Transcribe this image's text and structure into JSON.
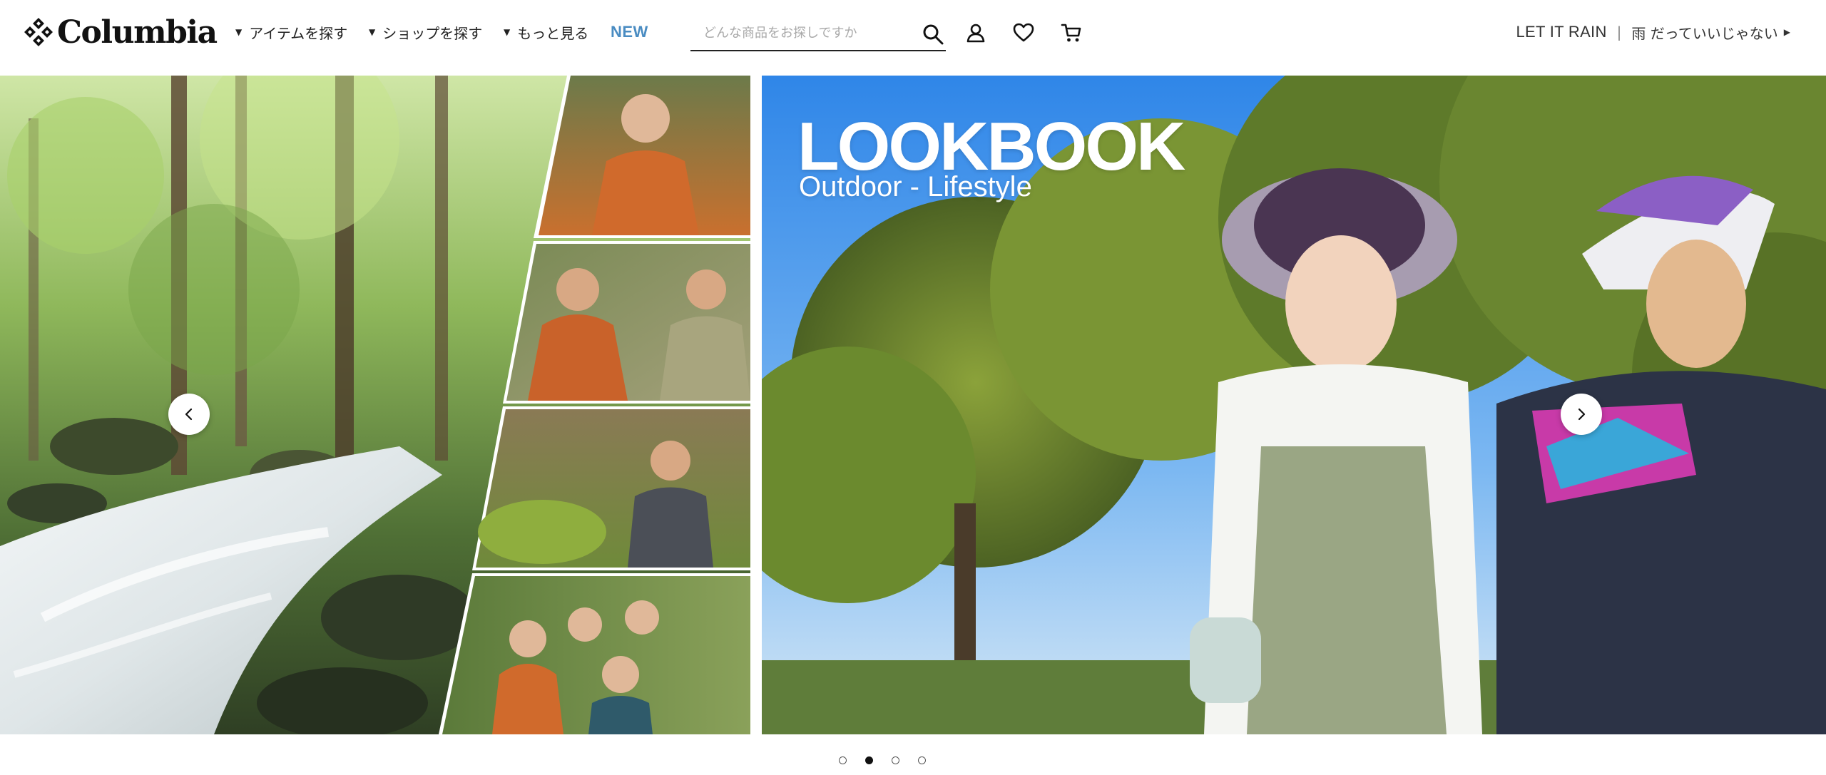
{
  "brand": {
    "logo_text": "Columbia"
  },
  "nav": {
    "items": [
      {
        "label": "アイテムを探す"
      },
      {
        "label": "ショップを探す"
      },
      {
        "label": "もっと見る"
      }
    ],
    "new_label": "NEW"
  },
  "search": {
    "placeholder": "どんな商品をお探しですか",
    "value": ""
  },
  "header_icons": [
    "search-icon",
    "account-icon",
    "heart-icon",
    "cart-icon"
  ],
  "promo": {
    "title": "LET IT RAIN",
    "separator": "|",
    "text": "雨 だっていいじゃない"
  },
  "hero": {
    "title": "LOOKBOOK",
    "subtitle": "Outdoor - Lifestyle",
    "slides_count": 4,
    "active_slide": 2
  },
  "colors": {
    "accent_new": "#4a8cc2",
    "text": "#1a1a1a",
    "background": "#ffffff"
  }
}
